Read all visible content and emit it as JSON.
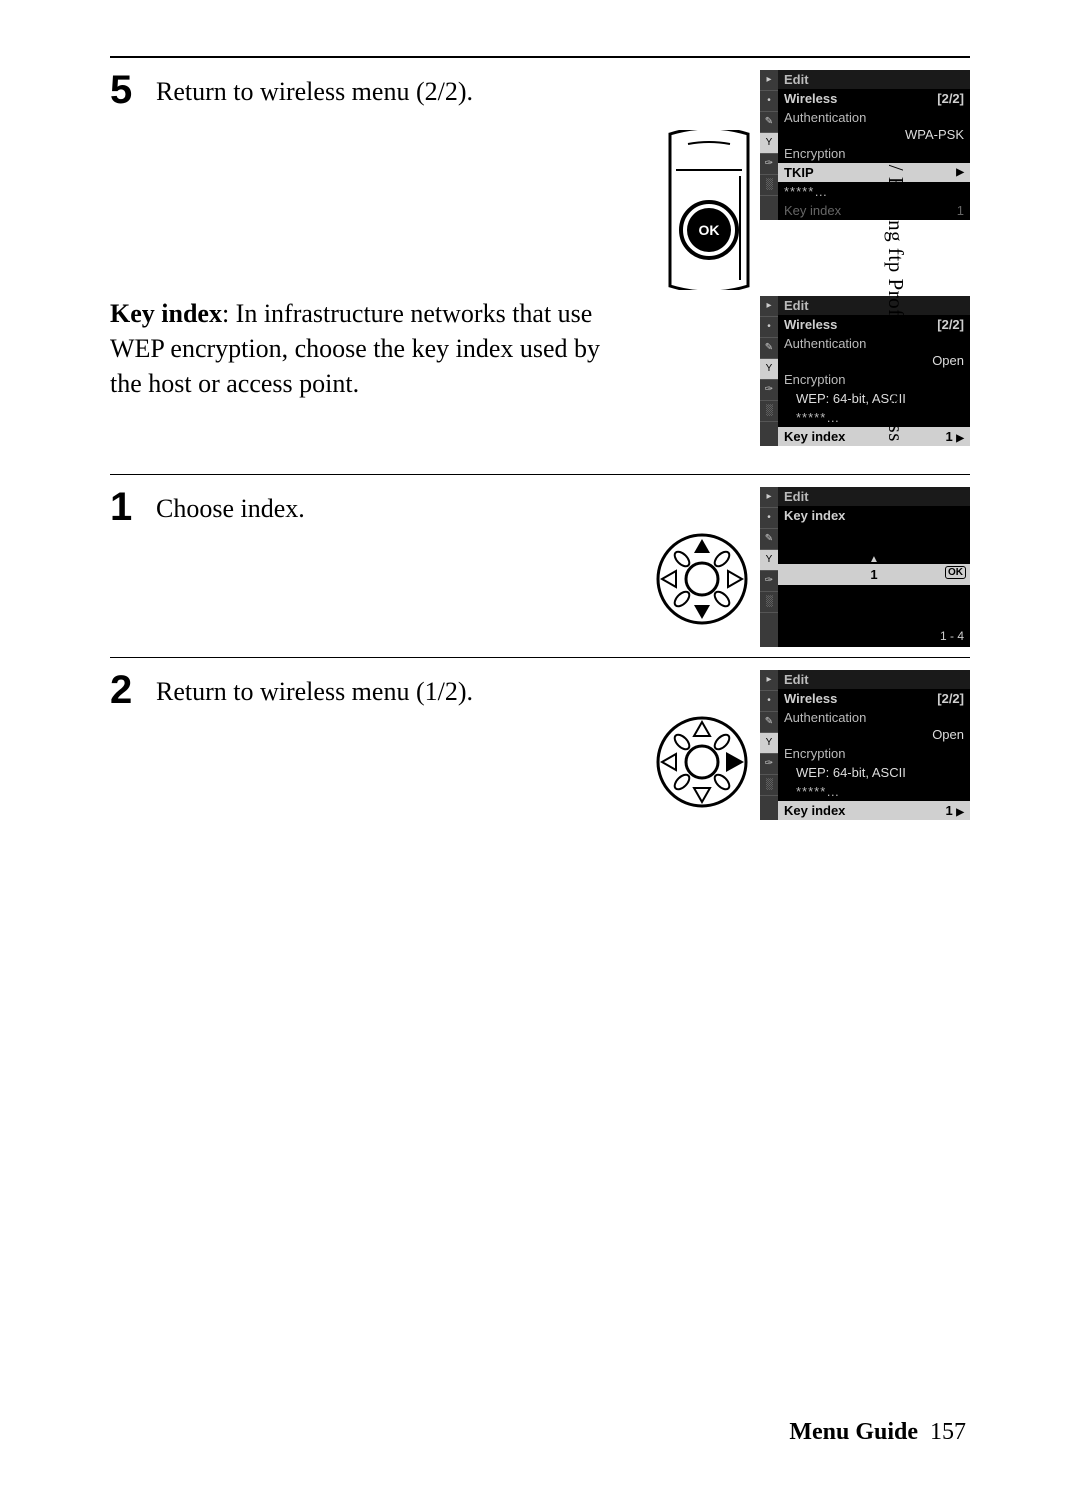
{
  "side_tab": "Mode / Editing ftp Profiles / Wireless",
  "steps": {
    "s5": {
      "num": "5",
      "text": "Return to wireless menu (2/2)."
    },
    "keyindex": {
      "label": "Key index",
      "text": ": In infrastructure networks that use WEP encryption, choose the key index used by the host or access point."
    },
    "s1": {
      "num": "1",
      "text": "Choose index."
    },
    "s2": {
      "num": "2",
      "text": "Return to wireless menu (1/2)."
    }
  },
  "lcd1": {
    "head": "Edit",
    "title": "Wireless",
    "page": "[2/2]",
    "auth_label": "Authentication",
    "auth_val": "WPA-PSK",
    "enc_label": "Encryption",
    "enc_val": "TKIP",
    "pw": "*****…",
    "key_label": "Key index",
    "key_val": "1"
  },
  "lcd2": {
    "head": "Edit",
    "title": "Wireless",
    "page": "[2/2]",
    "auth_label": "Authentication",
    "auth_val": "Open",
    "enc_label": "Encryption",
    "enc_val": "WEP: 64-bit, ASCII",
    "pw": "*****…",
    "key_label": "Key index",
    "key_val": "1"
  },
  "lcd3": {
    "head": "Edit",
    "title": "Key index",
    "value": "1",
    "range": "1 - 4",
    "ok": "OK"
  },
  "lcd4": {
    "head": "Edit",
    "title": "Wireless",
    "page": "[2/2]",
    "auth_label": "Authentication",
    "auth_val": "Open",
    "enc_label": "Encryption",
    "enc_val": "WEP: 64-bit, ASCII",
    "pw": "*****…",
    "key_label": "Key index",
    "key_val": "1"
  },
  "footer": {
    "label": "Menu Guide",
    "page": "157"
  }
}
